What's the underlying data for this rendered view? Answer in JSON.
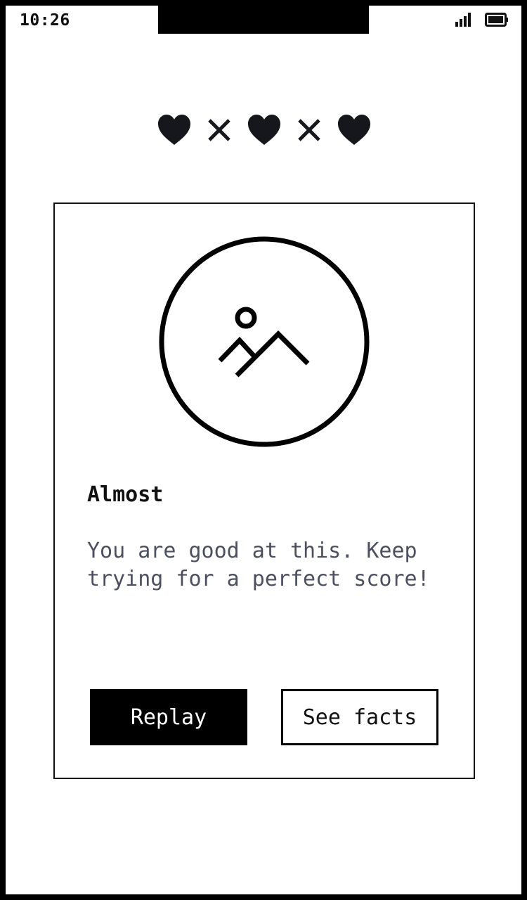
{
  "status_bar": {
    "time": "10:26",
    "signal_icon": "signal-icon",
    "battery_icon": "battery-icon"
  },
  "lives": [
    "heart-icon",
    "cross-icon",
    "heart-icon",
    "cross-icon",
    "heart-icon"
  ],
  "result": {
    "title": "Almost",
    "message": "You are good at this. Keep trying for a perfect score!",
    "illustration_icon": "image-placeholder-icon"
  },
  "actions": {
    "replay_label": "Replay",
    "see_facts_label": "See facts"
  },
  "colors": {
    "frame": "#000000",
    "background": "#ffffff",
    "text": "#111111",
    "message_text": "#4b5060"
  }
}
